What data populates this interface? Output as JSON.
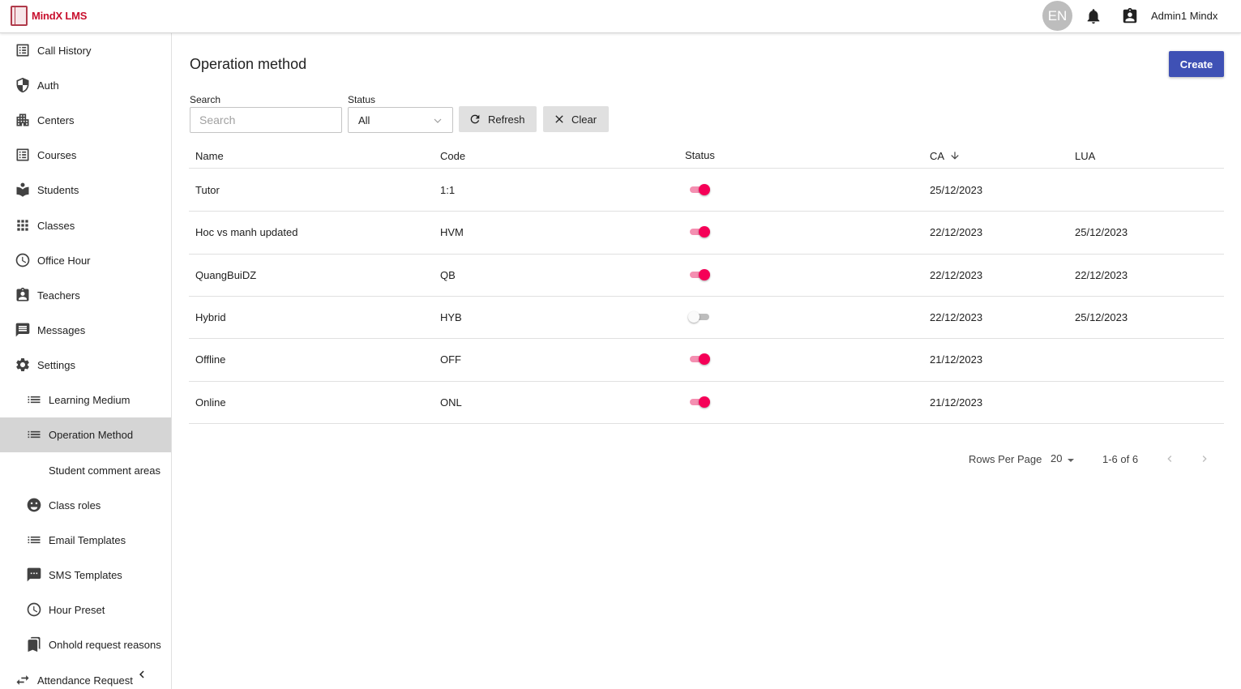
{
  "header": {
    "app_name": "MindX LMS",
    "language": "EN",
    "user_name": "Admin1 Mindx"
  },
  "sidebar": {
    "items": [
      {
        "label": "Call History",
        "icon": "list-alt-icon"
      },
      {
        "label": "Auth",
        "icon": "shield-icon"
      },
      {
        "label": "Centers",
        "icon": "building-icon"
      },
      {
        "label": "Courses",
        "icon": "list-alt-icon"
      },
      {
        "label": "Students",
        "icon": "student-book-icon"
      },
      {
        "label": "Classes",
        "icon": "grid-icon"
      },
      {
        "label": "Office Hour",
        "icon": "clock-icon"
      },
      {
        "label": "Teachers",
        "icon": "badge-icon"
      },
      {
        "label": "Messages",
        "icon": "message-icon"
      },
      {
        "label": "Settings",
        "icon": "gear-icon"
      },
      {
        "label": "Learning Medium",
        "icon": "list-icon"
      },
      {
        "label": "Operation Method",
        "icon": "list-icon",
        "active": true
      },
      {
        "label": "Student comment areas",
        "icon": ""
      },
      {
        "label": "Class roles",
        "icon": "roles-icon"
      },
      {
        "label": "Email Templates",
        "icon": "list-icon"
      },
      {
        "label": "SMS Templates",
        "icon": "sms-icon"
      },
      {
        "label": "Hour Preset",
        "icon": "clock-icon"
      },
      {
        "label": "Onhold request reasons",
        "icon": "bookmark-icon"
      },
      {
        "label": "Attendance Request",
        "icon": "swap-icon"
      }
    ]
  },
  "page": {
    "title": "Operation method",
    "create_label": "Create"
  },
  "filters": {
    "search_label": "Search",
    "search_placeholder": "Search",
    "status_label": "Status",
    "status_value": "All",
    "refresh_label": "Refresh",
    "clear_label": "Clear"
  },
  "table": {
    "columns": [
      "Name",
      "Code",
      "Status",
      "CA",
      "LUA"
    ],
    "sort_column": "CA",
    "rows": [
      {
        "name": "Tutor",
        "code": "1:1",
        "status": true,
        "ca": "25/12/2023",
        "lua": ""
      },
      {
        "name": "Hoc vs manh updated",
        "code": "HVM",
        "status": true,
        "ca": "22/12/2023",
        "lua": "25/12/2023"
      },
      {
        "name": "QuangBuiDZ",
        "code": "QB",
        "status": true,
        "ca": "22/12/2023",
        "lua": "22/12/2023"
      },
      {
        "name": "Hybrid",
        "code": "HYB",
        "status": false,
        "ca": "22/12/2023",
        "lua": "25/12/2023"
      },
      {
        "name": "Offline",
        "code": "OFF",
        "status": true,
        "ca": "21/12/2023",
        "lua": ""
      },
      {
        "name": "Online",
        "code": "ONL",
        "status": true,
        "ca": "21/12/2023",
        "lua": ""
      }
    ]
  },
  "pagination": {
    "rows_per_page_label": "Rows Per Page",
    "rows_per_page": "20",
    "range": "1-6 of 6"
  },
  "colors": {
    "primary": "#3f51b5",
    "toggle_on": "#f50057",
    "brand": "#c8102e"
  }
}
